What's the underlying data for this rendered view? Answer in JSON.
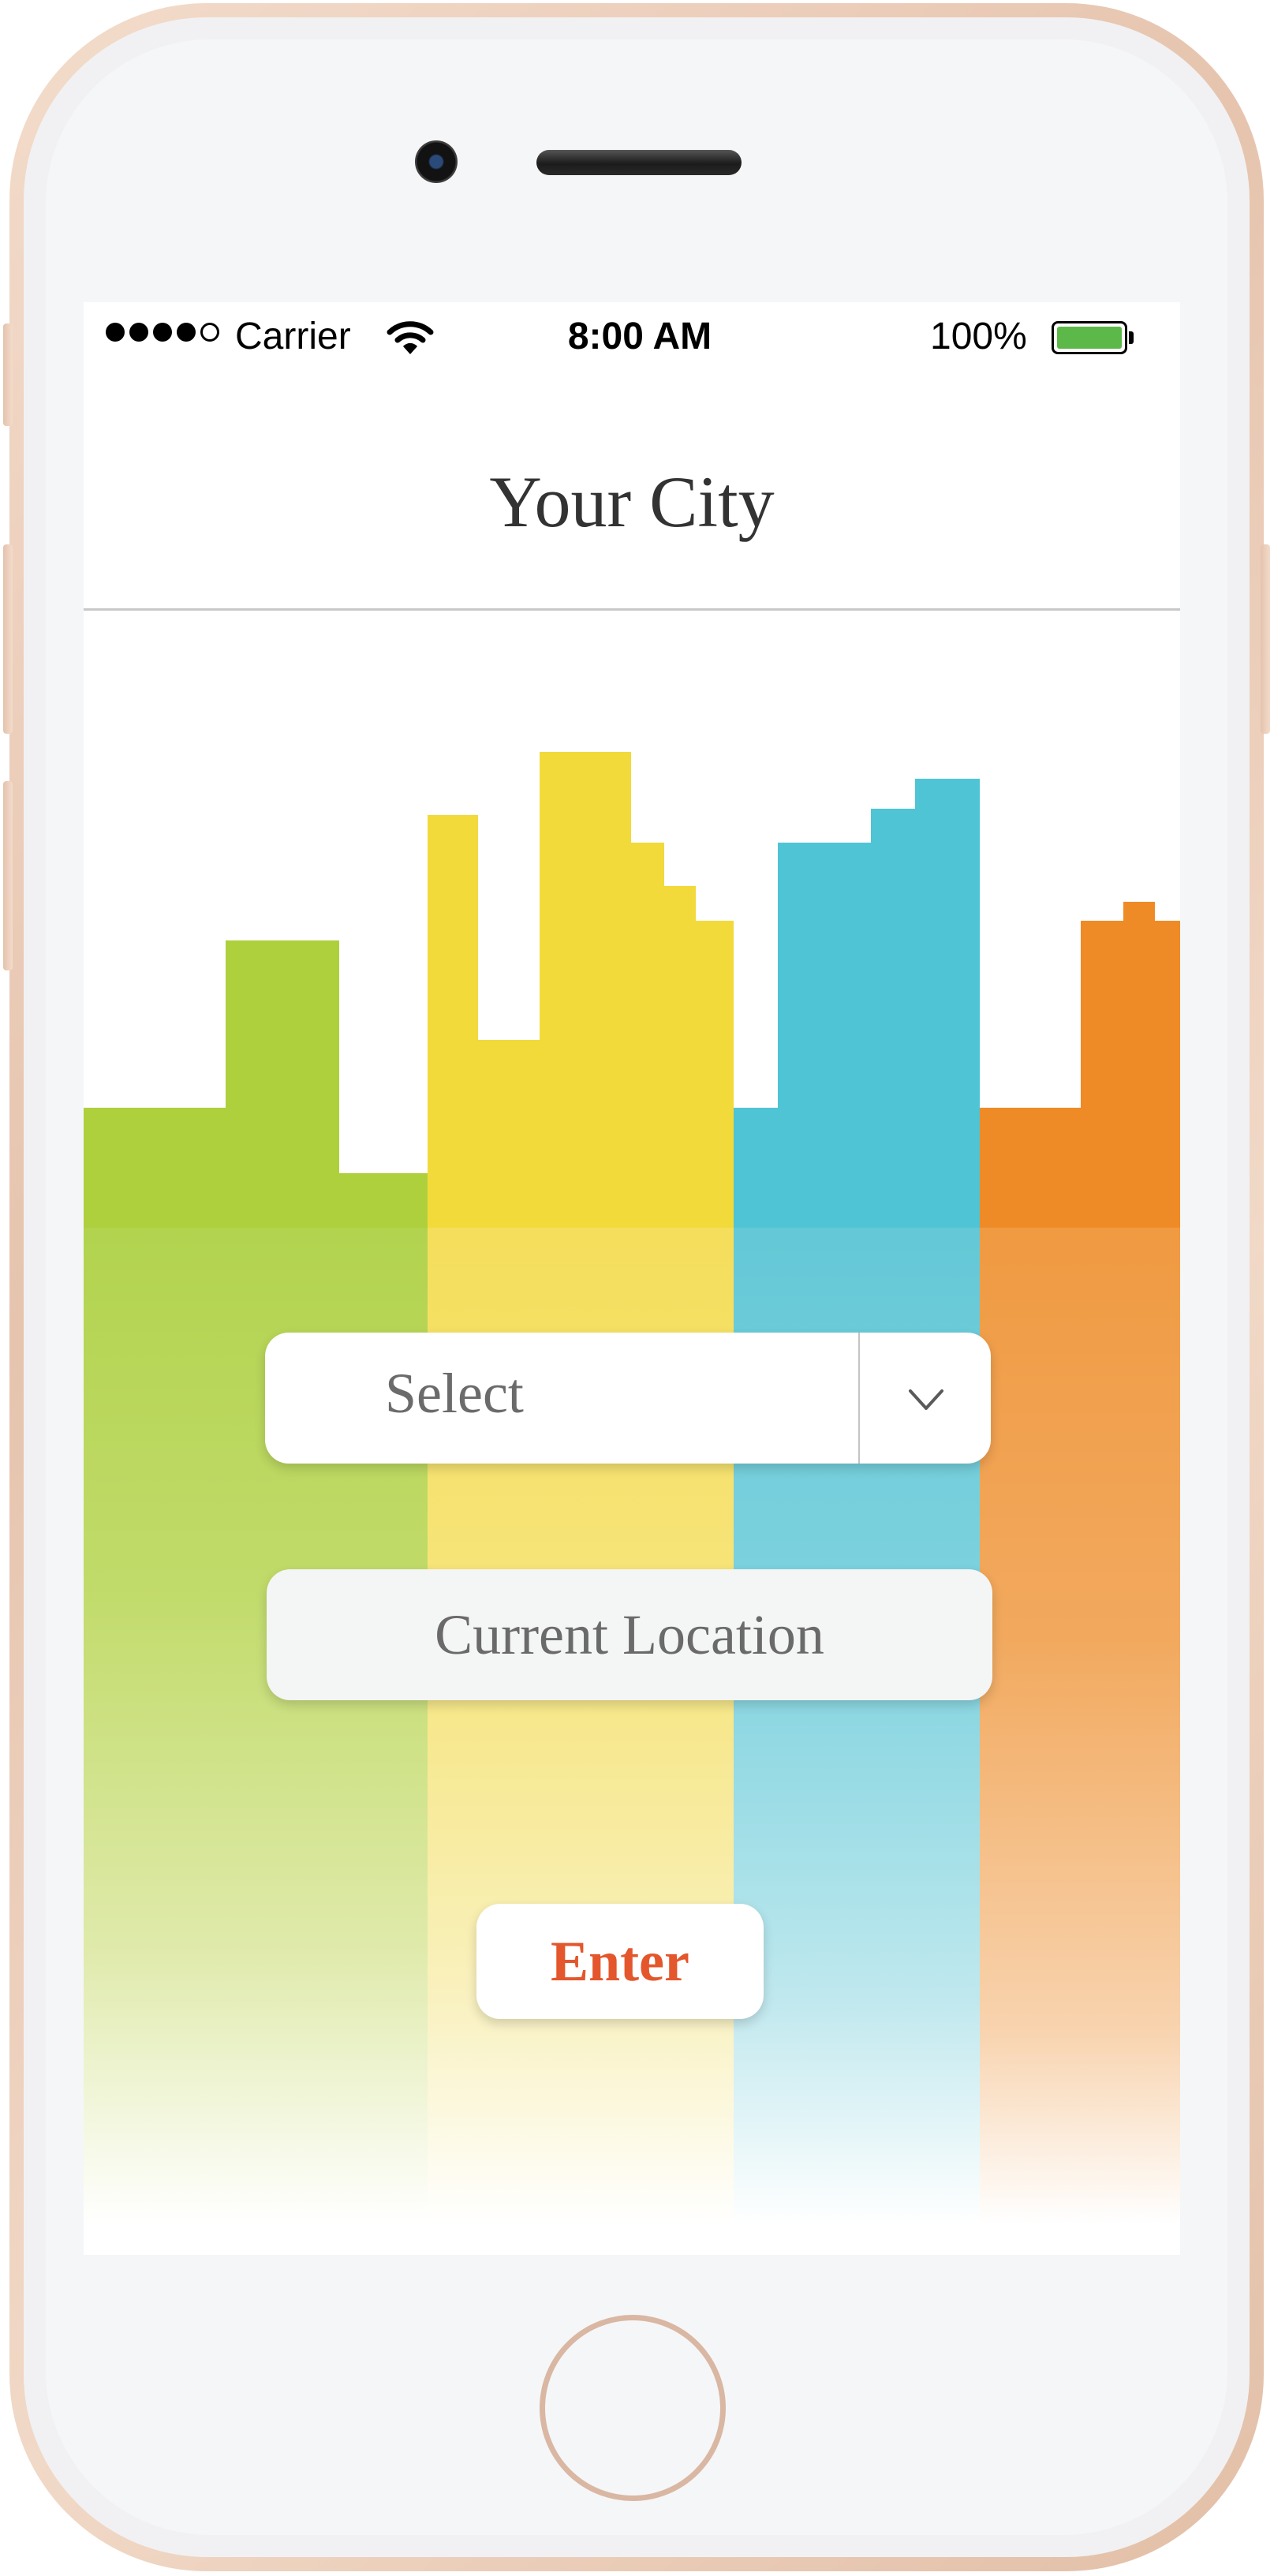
{
  "status_bar": {
    "carrier": "Carrier",
    "time": "8:00 AM",
    "battery_percent": "100%",
    "signal_bars_filled": 4,
    "signal_bars_total": 5,
    "battery_level": 1.0
  },
  "header": {
    "title": "Your City"
  },
  "city_select": {
    "placeholder": "Select",
    "icon": "chevron-down-icon"
  },
  "current_location": {
    "label": "Current Location"
  },
  "enter_button": {
    "label": "Enter"
  },
  "colors": {
    "green": "#aed03c",
    "yellow": "#f2da3a",
    "blue": "#4fc4d5",
    "orange": "#ee8b27",
    "accent_red": "#e4562c",
    "battery_green": "#5cb849"
  }
}
